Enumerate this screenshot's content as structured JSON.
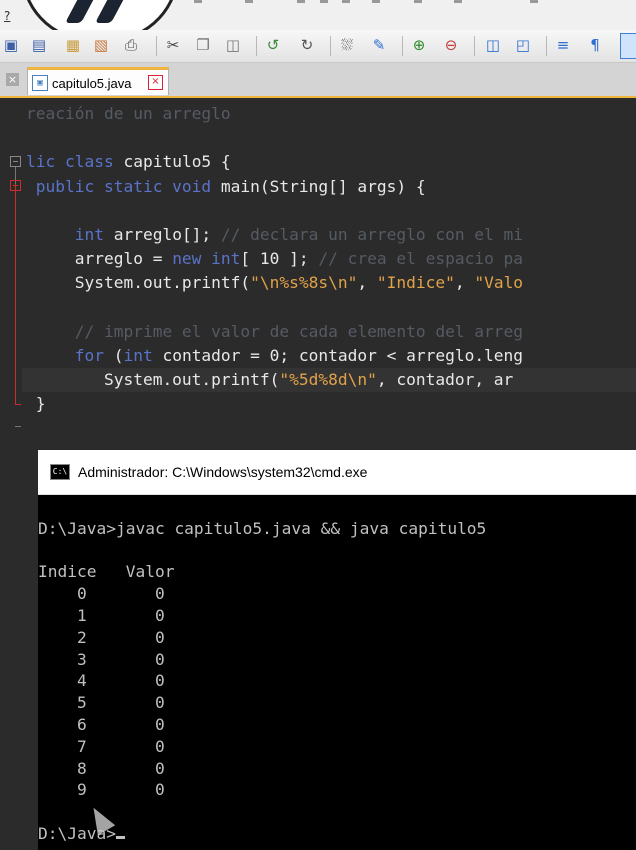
{
  "menu": {
    "help_marker": "?"
  },
  "tab": {
    "filename": "capitulo5.java"
  },
  "editor": {
    "lines": [
      [
        {
          "t": "cm",
          "v": "reación de un arreglo"
        }
      ],
      [],
      [
        {
          "t": "kw",
          "v": "lic class "
        },
        {
          "t": "nm",
          "v": "capitulo5 {"
        }
      ],
      [
        {
          "t": "kw",
          "v": " public static void "
        },
        {
          "t": "nm",
          "v": "main(String[] args) {"
        }
      ],
      [],
      [
        {
          "t": "kw",
          "v": "     int "
        },
        {
          "t": "nm",
          "v": "arreglo[]; "
        },
        {
          "t": "cm",
          "v": "// declara un arreglo con el mi"
        }
      ],
      [
        {
          "t": "nm",
          "v": "     arreglo = "
        },
        {
          "t": "kw",
          "v": "new int"
        },
        {
          "t": "nm",
          "v": "[ 10 ]; "
        },
        {
          "t": "cm",
          "v": "// crea el espacio pa"
        }
      ],
      [
        {
          "t": "nm",
          "v": "     System.out.printf("
        },
        {
          "t": "st",
          "v": "\"\\n%s%8s\\n\""
        },
        {
          "t": "nm",
          "v": ", "
        },
        {
          "t": "st",
          "v": "\"Indice\""
        },
        {
          "t": "nm",
          "v": ", "
        },
        {
          "t": "st",
          "v": "\"Valo"
        }
      ],
      [],
      [
        {
          "t": "cm",
          "v": "     // imprime el valor de cada elemento del arreg"
        }
      ],
      [
        {
          "t": "kw",
          "v": "     for "
        },
        {
          "t": "nm",
          "v": "("
        },
        {
          "t": "kw",
          "v": "int "
        },
        {
          "t": "nm",
          "v": "contador = 0; contador < arreglo.leng"
        }
      ],
      [
        {
          "t": "nm",
          "v": "        System.out.printf("
        },
        {
          "t": "st",
          "v": "\"%5d%8d\\n\""
        },
        {
          "t": "nm",
          "v": ", contador, ar"
        }
      ],
      [
        {
          "t": "nm",
          "v": " }"
        }
      ]
    ]
  },
  "console": {
    "title": "Administrador: C:\\Windows\\system32\\cmd.exe",
    "icon_label": "C:\\",
    "lines": [
      "",
      "D:\\Java>javac capitulo5.java && java capitulo5",
      "",
      "Indice   Valor",
      "    0       0",
      "    1       0",
      "    2       0",
      "    3       0",
      "    4       0",
      "    5       0",
      "    6       0",
      "    7       0",
      "    8       0",
      "    9       0",
      "",
      "D:\\Java>"
    ]
  }
}
